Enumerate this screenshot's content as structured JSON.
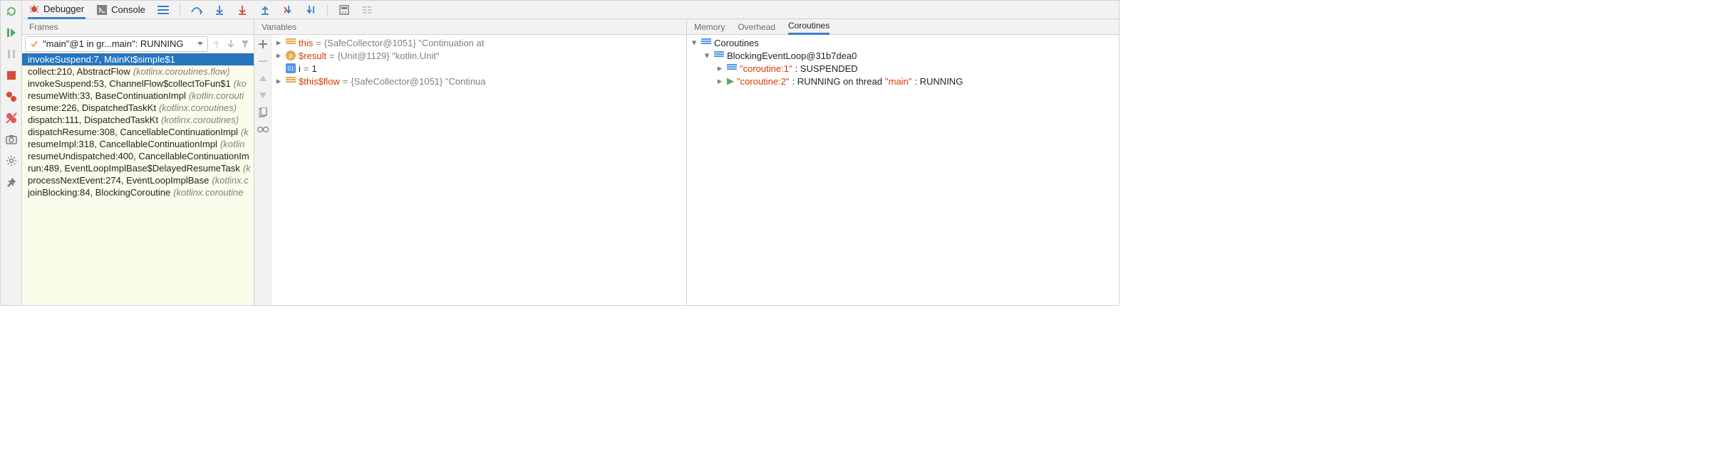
{
  "toolbar": {
    "debugger_label": "Debugger",
    "console_label": "Console"
  },
  "frames": {
    "header": "Frames",
    "thread": "\"main\"@1 in gr...main\": RUNNING",
    "items": [
      {
        "method": "invokeSuspend:7, MainKt$simple$1",
        "cls": ""
      },
      {
        "method": "collect:210, AbstractFlow",
        "cls": "(kotlinx.coroutines.flow)"
      },
      {
        "method": "invokeSuspend:53, ChannelFlow$collectToFun$1",
        "cls": "(ko"
      },
      {
        "method": "resumeWith:33, BaseContinuationImpl",
        "cls": "(kotlin.corouti"
      },
      {
        "method": "resume:226, DispatchedTaskKt",
        "cls": "(kotlinx.coroutines)"
      },
      {
        "method": "dispatch:111, DispatchedTaskKt",
        "cls": "(kotlinx.coroutines)"
      },
      {
        "method": "dispatchResume:308, CancellableContinuationImpl",
        "cls": "(k"
      },
      {
        "method": "resumeImpl:318, CancellableContinuationImpl",
        "cls": "(kotlin"
      },
      {
        "method": "resumeUndispatched:400, CancellableContinuationIm",
        "cls": ""
      },
      {
        "method": "run:489, EventLoopImplBase$DelayedResumeTask",
        "cls": "(k"
      },
      {
        "method": "processNextEvent:274, EventLoopImplBase",
        "cls": "(kotlinx.c"
      },
      {
        "method": "joinBlocking:84, BlockingCoroutine",
        "cls": "(kotlinx.coroutine"
      }
    ]
  },
  "variables": {
    "header": "Variables",
    "rows": [
      {
        "name": "this",
        "eq": " = ",
        "val": "{SafeCollector@1051} \"Continuation at"
      },
      {
        "name": "$result",
        "eq": " = ",
        "val": "{Unit@1129} \"kotlin.Unit\""
      },
      {
        "name": "i",
        "eq": " = ",
        "val": "1"
      },
      {
        "name": "$this$flow",
        "eq": " = ",
        "val": "{SafeCollector@1051} \"Continua"
      }
    ]
  },
  "coroutines": {
    "tab_memory": "Memory",
    "tab_overhead": "Overhead",
    "tab_coroutines": "Coroutines",
    "root": "Coroutines",
    "loop": "BlockingEventLoop@31b7dea0",
    "c1_name": "\"coroutine:1\"",
    "c1_rest": ": SUSPENDED",
    "c2_name": "\"coroutine:2\"",
    "c2_mid": ": RUNNING on thread ",
    "c2_thread": "\"main\"",
    "c2_rest": ": RUNNING"
  }
}
